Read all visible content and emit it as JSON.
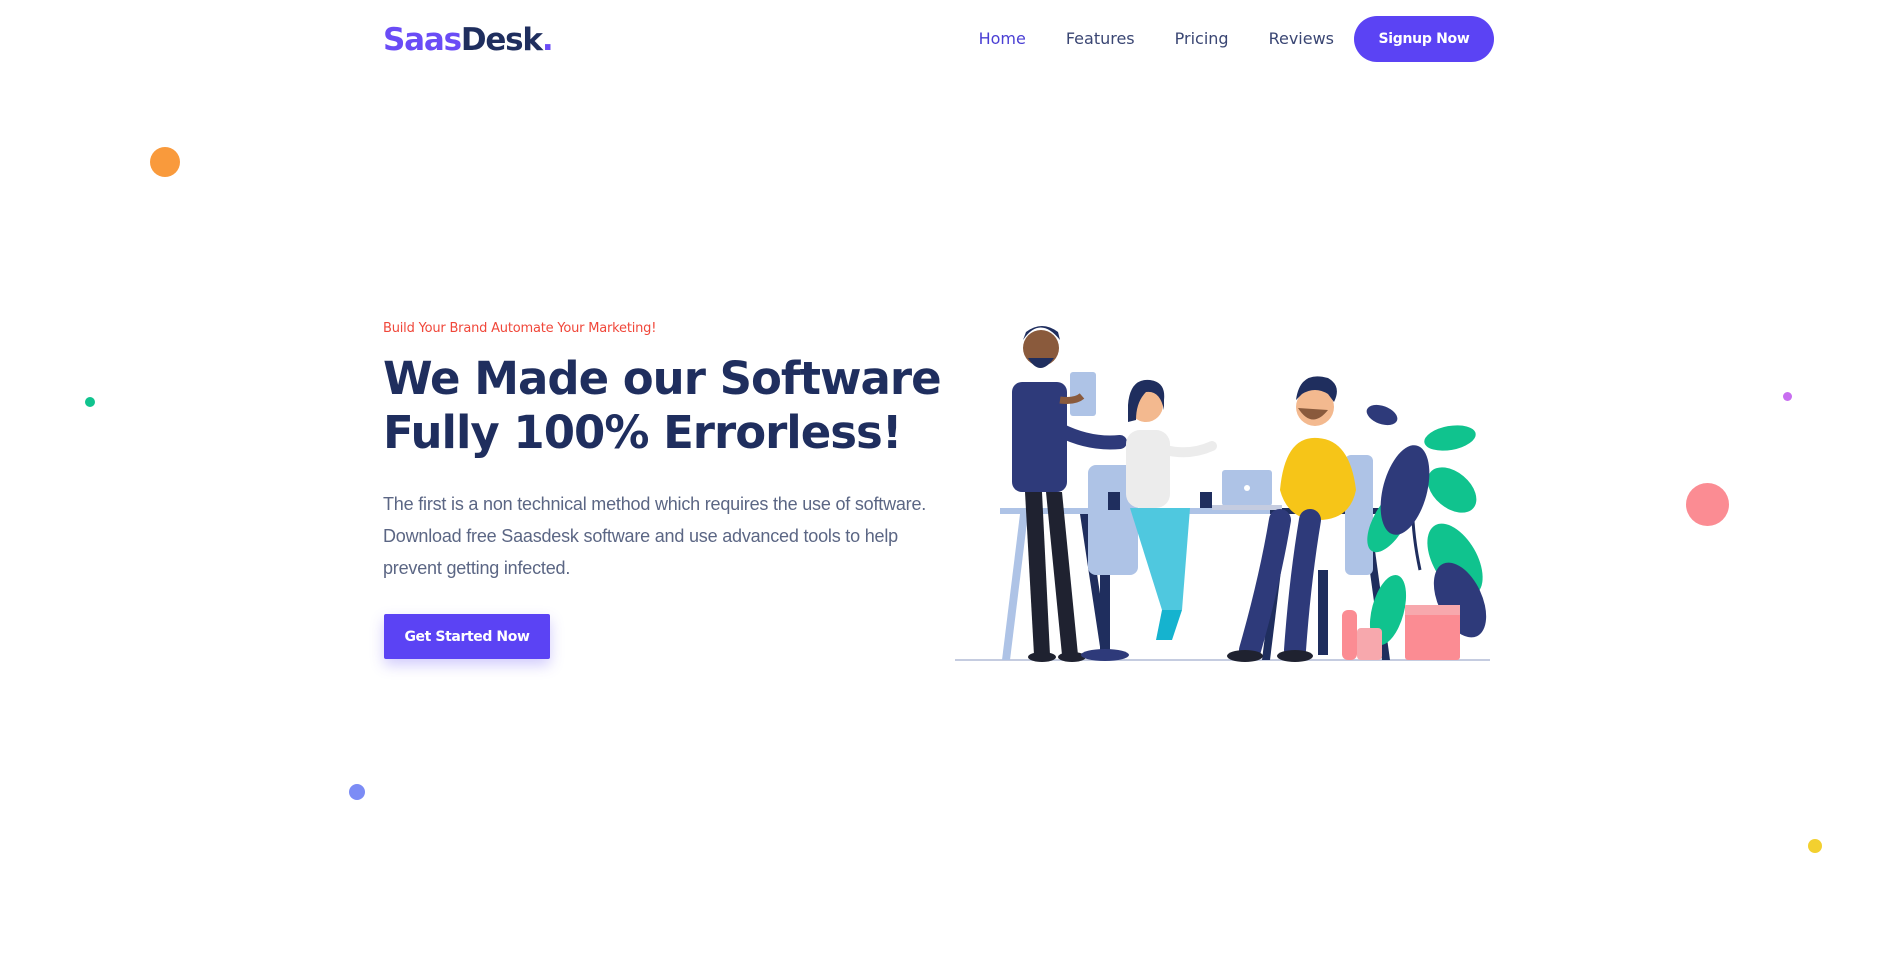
{
  "brand": {
    "logo_part1": "Saas",
    "logo_part2": "Desk",
    "logo_dot": ".",
    "primary_color": "#5b43f4",
    "dark_color": "#1f2e5e"
  },
  "nav": {
    "items": [
      {
        "label": "Home",
        "active": true
      },
      {
        "label": "Features",
        "active": false
      },
      {
        "label": "Pricing",
        "active": false
      },
      {
        "label": "Reviews",
        "active": false
      }
    ],
    "signup_label": "Signup Now"
  },
  "hero": {
    "eyebrow": "Build Your Brand Automate Your Marketing!",
    "title_line1": "We Made our Software",
    "title_line2": "Fully 100% Errorless!",
    "description": "The first is a non technical method which requires the use of software. Download free Saasdesk software and use advanced tools to help prevent getting infected.",
    "cta_label": "Get Started Now",
    "eyebrow_color": "#f0473a"
  },
  "decor": {
    "dot_colors": [
      "#f99a3c",
      "#10c38e",
      "#7c8cf5",
      "#c86ef0",
      "#fb8c93",
      "#f3d02f"
    ]
  },
  "illustration": {
    "icon": "team-office-illustration"
  }
}
